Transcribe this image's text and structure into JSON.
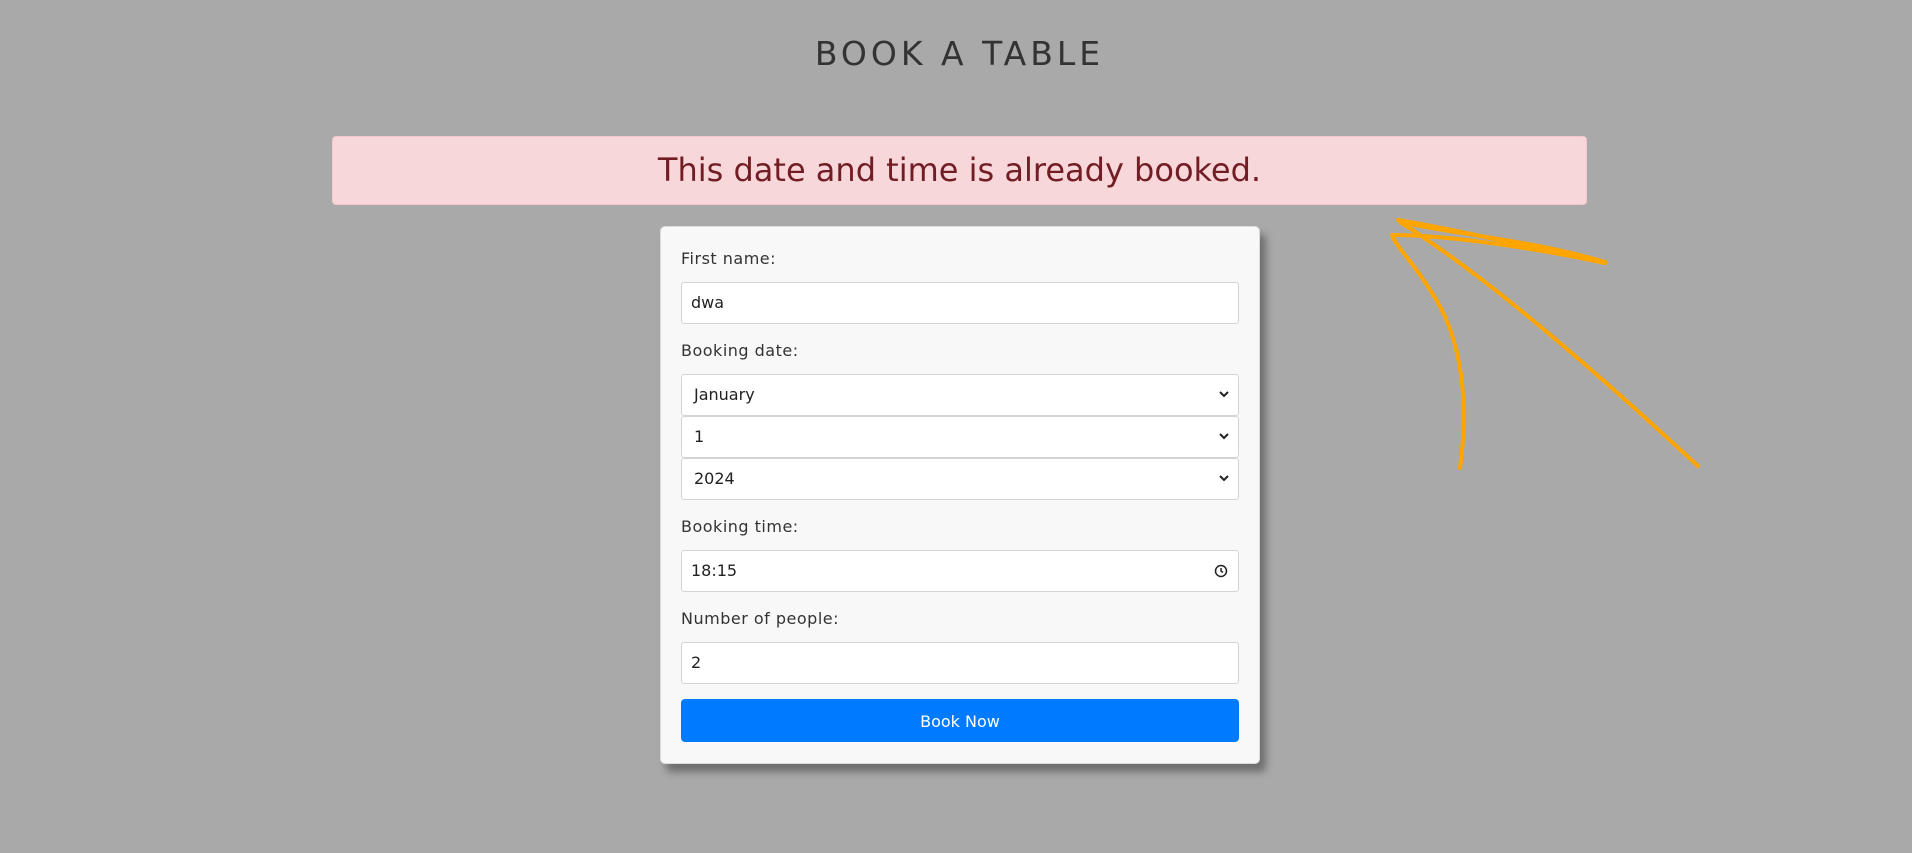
{
  "page": {
    "title": "BOOK A TABLE"
  },
  "alert": {
    "message": "This date and time is already booked."
  },
  "form": {
    "first_name_label": "First name:",
    "first_name_value": "dwa",
    "booking_date_label": "Booking date:",
    "month_value": "January",
    "day_value": "1",
    "year_value": "2024",
    "booking_time_label": "Booking time:",
    "time_value": "18:15",
    "people_label": "Number of people:",
    "people_value": "2",
    "submit_label": "Book Now"
  },
  "colors": {
    "background": "#a9a9a9",
    "alert_bg": "#f8d7da",
    "alert_text": "#721c24",
    "button": "#007bff",
    "annotation": "#ffa500"
  },
  "icons": {
    "select_chevron": "chevron-down-icon",
    "time_picker": "clock-icon",
    "annotation": "arrow-annotation-icon"
  }
}
